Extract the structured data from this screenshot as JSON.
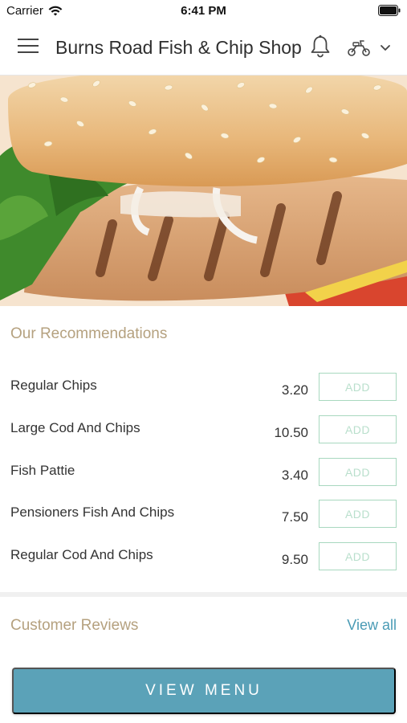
{
  "status_bar": {
    "carrier": "Carrier",
    "time": "6:41 PM"
  },
  "header": {
    "title": "Burns Road Fish & Chip Shop",
    "menu_icon": "hamburger-menu-icon",
    "notifications_icon": "bell-icon",
    "delivery_icon": "scooter-icon",
    "dropdown_icon": "chevron-down-icon"
  },
  "hero": {
    "image": "grilled-chicken-burger-photo"
  },
  "recommendations": {
    "title": "Our Recommendations",
    "items": [
      {
        "name": "Regular Chips",
        "price": "3.20",
        "add_label": "ADD"
      },
      {
        "name": "Large Cod And Chips",
        "price": "10.50",
        "add_label": "ADD"
      },
      {
        "name": "Fish Pattie",
        "price": "3.40",
        "add_label": "ADD"
      },
      {
        "name": "Pensioners Fish And Chips",
        "price": "7.50",
        "add_label": "ADD"
      },
      {
        "name": "Regular Cod And Chips",
        "price": "9.50",
        "add_label": "ADD"
      }
    ]
  },
  "reviews": {
    "title": "Customer Reviews",
    "view_all_label": "View all"
  },
  "footer": {
    "view_menu_label": "VIEW MENU"
  },
  "colors": {
    "accent_gold": "#b5a17f",
    "link_blue": "#4a9bb5",
    "button_teal": "#5ba2b8",
    "add_border_green": "#a8d8bf"
  }
}
